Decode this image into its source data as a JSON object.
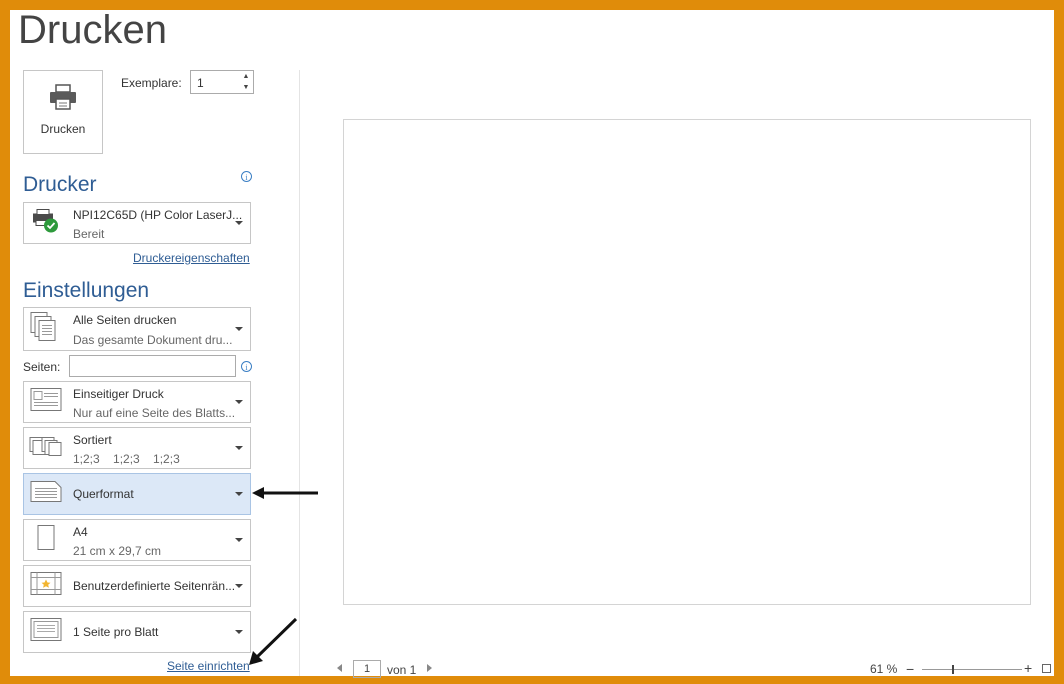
{
  "title": "Drucken",
  "print_button": {
    "label": "Drucken",
    "icon": "printer-icon"
  },
  "copies": {
    "label": "Exemplare:",
    "value": "1"
  },
  "printer_section": {
    "heading": "Drucker",
    "info": "i"
  },
  "printer": {
    "name": "NPI12C65D (HP Color LaserJ...",
    "status": "Bereit",
    "icon": "printer-ready-icon"
  },
  "printer_props_link": "Druckereigenschaften",
  "settings_section": {
    "heading": "Einstellungen"
  },
  "settings": {
    "pages_scope": {
      "title": "Alle Seiten drucken",
      "subtitle": "Das gesamte Dokument dru..."
    },
    "pages_field": {
      "label": "Seiten:",
      "value": "",
      "info": "i"
    },
    "sides": {
      "title": "Einseitiger Druck",
      "subtitle": "Nur auf eine Seite des Blatts..."
    },
    "collate": {
      "title": "Sortiert",
      "subtitle": "1;2;3    1;2;3    1;2;3"
    },
    "orientation": {
      "title": "Querformat"
    },
    "paper": {
      "title": "A4",
      "subtitle": "21 cm x 29,7 cm"
    },
    "margins": {
      "title": "Benutzerdefinierte Seitenrän..."
    },
    "pages_per_sheet": {
      "title": "1 Seite pro Blatt"
    }
  },
  "page_setup_link": "Seite einrichten",
  "pager": {
    "current": "1",
    "of_text": "von 1"
  },
  "zoom": {
    "value": "61 %",
    "minus": "−",
    "plus": "+",
    "level_fraction": 0.3
  },
  "colors": {
    "frame": "#e08c0a",
    "heading": "#2f5d94",
    "selected": "#dce8f7"
  }
}
